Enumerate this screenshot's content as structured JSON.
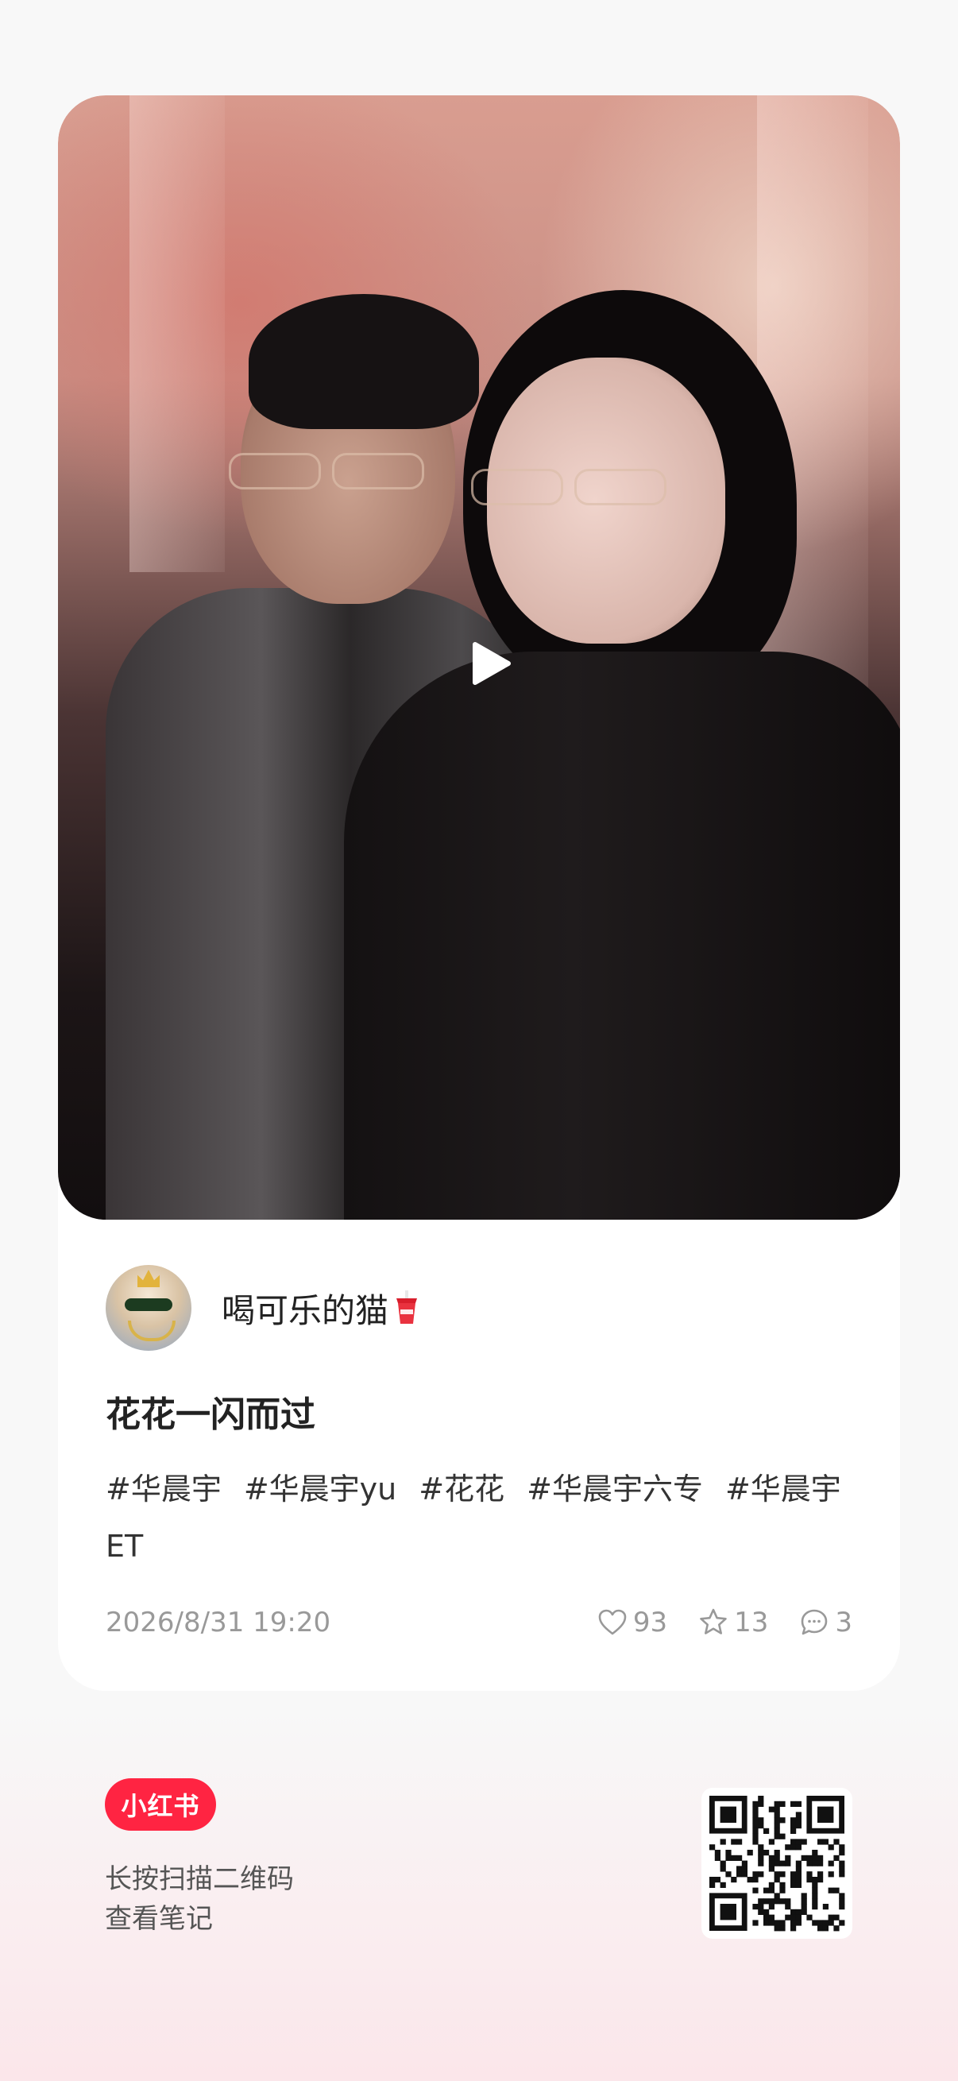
{
  "post": {
    "author_name": "喝可乐的猫",
    "title": "花花一闪而过",
    "tags": [
      "#华晨宇",
      "#华晨宇yu",
      "#花花",
      "#华晨宇六专",
      "#华晨宇ET"
    ],
    "date": "2026/8/31 19:20",
    "likes": "93",
    "favorites": "13",
    "comments": "3"
  },
  "footer": {
    "brand": "小红书",
    "line1": "长按扫描二维码",
    "line2": "查看笔记"
  },
  "colors": {
    "brand_red": "#ff2442",
    "text_muted": "#999999"
  },
  "icons": [
    "play-icon",
    "heart-icon",
    "star-icon",
    "comment-icon",
    "cup-icon",
    "qr-code"
  ]
}
